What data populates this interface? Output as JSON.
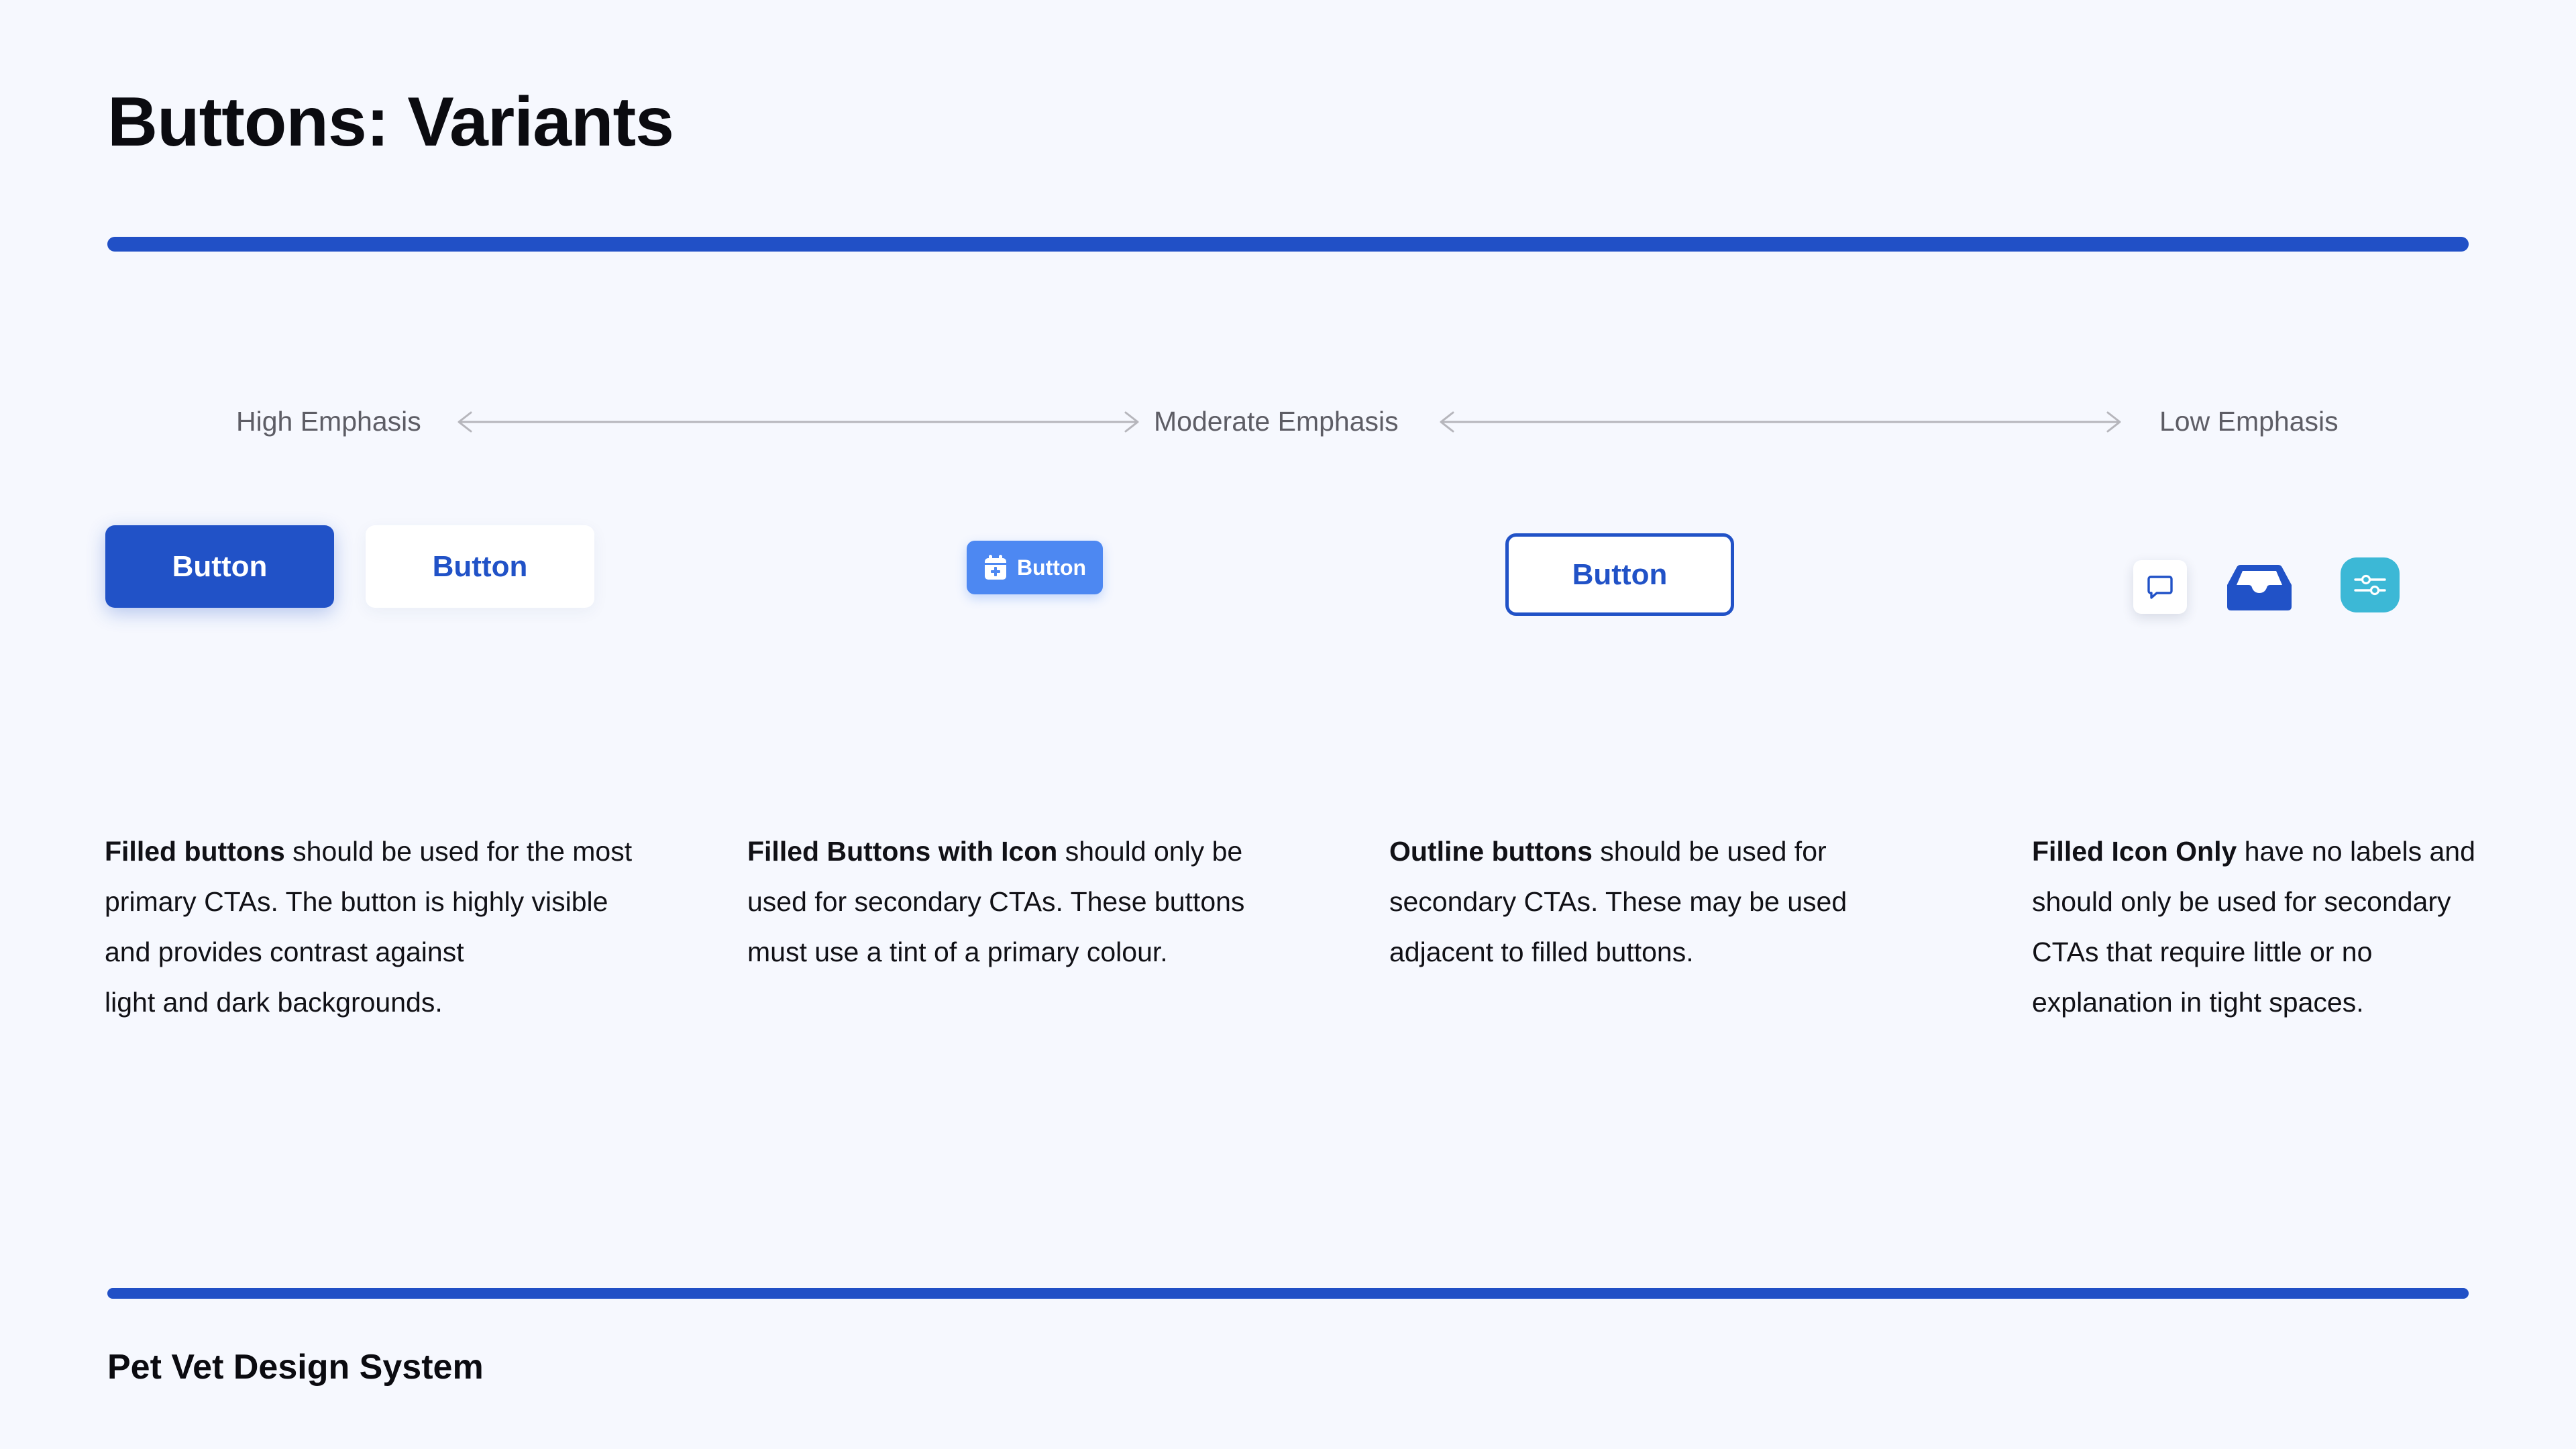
{
  "page": {
    "title": "Buttons: Variants",
    "footer": "Pet Vet Design System"
  },
  "emphasis_scale": {
    "high": "High Emphasis",
    "moderate": "Moderate Emphasis",
    "low": "Low Emphasis"
  },
  "buttons": {
    "filled": "Button",
    "white": "Button",
    "filled_with_icon": "Button",
    "outline": "Button"
  },
  "icons": {
    "filled_with_icon": "calendar-plus-icon",
    "chat": "chat-bubble-icon",
    "inbox": "inbox-tray-icon",
    "sliders": "sliders-icon"
  },
  "descriptions": [
    {
      "strong": "Filled buttons",
      "line1": " should be used for the most",
      "line2": "primary CTAs. The button is highly visible",
      "line3": "and provides contrast against",
      "line4": "light and dark backgrounds."
    },
    {
      "strong": "Filled Buttons with Icon",
      "line1": " should only be",
      "line2": "used for secondary CTAs. These buttons",
      "line3": "must use a tint of a primary colour."
    },
    {
      "strong": "Outline buttons",
      "line1": " should be used for",
      "line2": "secondary CTAs. These may be used",
      "line3": "adjacent to filled buttons."
    },
    {
      "strong": "Filled Icon Only",
      "line1": " have no labels and",
      "line2": "should only be used for secondary",
      "line3": "CTAs that require little or no",
      "line4": "explanation in tight spaces."
    }
  ],
  "colors": {
    "primary": "#2152C7",
    "tint": "#4D88F2",
    "teal": "#3CB8D6",
    "background": "#F6F8FE"
  }
}
